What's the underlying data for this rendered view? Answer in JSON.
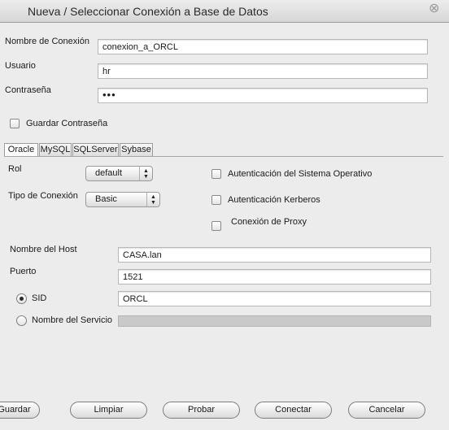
{
  "window": {
    "title": "Nueva / Seleccionar Conexión a Base de Datos",
    "close_glyph": "⊗"
  },
  "connection": {
    "name_label": "Nombre de Conexión",
    "name_value": "conexion_a_ORCL",
    "user_label": "Usuario",
    "user_value": "hr",
    "password_label": "Contraseña",
    "password_value": "•••",
    "save_password_label": "Guardar Contraseña"
  },
  "tabs": [
    "Oracle",
    "MySQL",
    "SQLServer",
    "Sybase"
  ],
  "oracle": {
    "role_label": "Rol",
    "role_value": "default",
    "conn_type_label": "Tipo de Conexión",
    "conn_type_value": "Basic",
    "os_auth_label": "Autenticación del Sistema Operativo",
    "kerberos_label": "Autenticación Kerberos",
    "proxy_label": "Conexión de Proxy",
    "host_label": "Nombre del Host",
    "host_value": "CASA.lan",
    "port_label": "Puerto",
    "port_value": "1521",
    "sid_label": "SID",
    "sid_value": "ORCL",
    "service_label": "Nombre del Servicio",
    "service_value": ""
  },
  "buttons": {
    "save": "Guardar",
    "clear": "Limpiar",
    "test": "Probar",
    "connect": "Conectar",
    "cancel": "Cancelar"
  }
}
